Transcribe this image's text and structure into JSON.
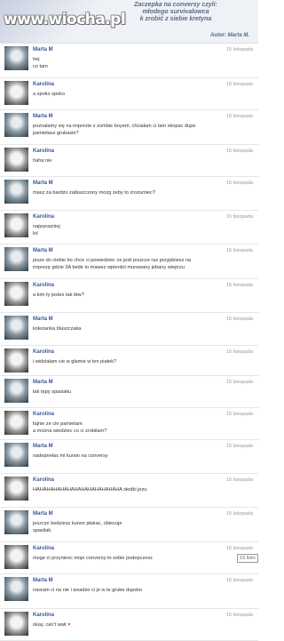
{
  "header": {
    "watermark": "www.wiocha.pl",
    "lines": [
      "Zaczepka na conversy czyli:",
      "młodego survivalowca",
      "k zrobić z siebie kretyna"
    ],
    "author": "Autor: Marta M."
  },
  "messages": [
    {
      "sender": "Marta M",
      "date": "15 listopada",
      "lines": [
        "hej",
        "co tam"
      ]
    },
    {
      "sender": "Karolina",
      "date": "15 listopada",
      "lines": [
        "a spoko spoko"
      ]
    },
    {
      "sender": "Marta M",
      "date": "15 listopada",
      "lines": [
        "poznałamy się na imprezie z zombie boyem, chciałam ci tam skopac dupe",
        "pamietasz grubasie?"
      ]
    },
    {
      "sender": "Karolina",
      "date": "15 listopada",
      "lines": [
        "haha nie"
      ]
    },
    {
      "sender": "Marta M",
      "date": "15 listopada",
      "lines": [
        "masz za bardzo zatłuszczony mozg zeby to zrozumiec?"
      ]
    },
    {
      "sender": "Karolina",
      "date": "15 listopada",
      "lines": [
        "najwyrazniej",
        "lol"
      ]
    },
    {
      "sender": "Marta M",
      "date": "15 listopada",
      "lines": [
        "pisze do ciebie bo chce ci powiedziec ze jesli jeszcze raz przyjdziesz na",
        "imprezę gdzie 3A bede to mawez wpierdol murowany jebany wieprzu"
      ]
    },
    {
      "sender": "Karolina",
      "date": "15 listopada",
      "lines": [
        "a kim ty jestes tak btw?"
      ]
    },
    {
      "sender": "Marta M",
      "date": "15 listopada",
      "lines": [
        "koleżanka blaszczaka"
      ]
    },
    {
      "sender": "Karolina",
      "date": "15 listopada",
      "lines": [
        "i widziałam cie w glamie w ten piatek?"
      ]
    },
    {
      "sender": "Marta M",
      "date": "15 listopada",
      "lines": [
        "tak tępy spasiaku"
      ]
    },
    {
      "sender": "Karolina",
      "date": "15 listopada",
      "lines": [
        "fajnie ze cie pamietam",
        "a można wiedziec co ci zrobilam?"
      ]
    },
    {
      "sender": "Marta M",
      "date": "15 listopada",
      "lines": [
        "nadepnełas mi kurwo na conversy"
      ]
    },
    {
      "sender": "Karolina",
      "date": "15 listopada",
      "lines": [
        "HAHAHAHAHAHAHAHAHAHAHAHAHA słodki jezu"
      ]
    },
    {
      "sender": "Marta M",
      "date": "15 listopada",
      "lines": [
        "jeszcze bedziesz kurwo płakac, obiecuje",
        "spasilak."
      ]
    },
    {
      "sender": "Karolina",
      "date": "15 listopada",
      "lines": [
        "moge ci przyniesc moje conversy to sobie podepczesz"
      ]
    },
    {
      "sender": "Marta M",
      "date": "15 listopada",
      "lines": [
        "nasram ci na nie i wsadze ci je w te grube dupsko"
      ]
    },
    {
      "sender": "Karolina",
      "date": "15 listopada",
      "lines": [
        "okay, can't wait"
      ]
    }
  ],
  "tooltip": "15 listo",
  "heart_icon": "heart"
}
